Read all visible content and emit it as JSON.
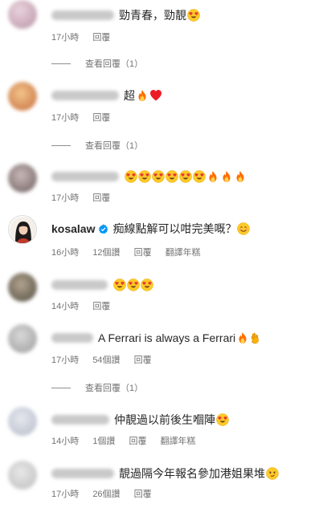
{
  "comments": [
    {
      "text": "勁青春，勁靚",
      "time": "17小時",
      "reply": "回覆",
      "view_replies": "查看回覆（1）"
    },
    {
      "text": "超",
      "time": "17小時",
      "reply": "回覆",
      "view_replies": "查看回覆（1）"
    },
    {
      "text": "",
      "time": "17小時",
      "reply": "回覆"
    },
    {
      "username": "kosalaw",
      "text": "痴線點解可以咁完美嘅？",
      "time": "16小時",
      "likes": "12個讚",
      "reply": "回覆",
      "translate": "翻譯年糕"
    },
    {
      "text": "",
      "time": "14小時",
      "reply": "回覆"
    },
    {
      "text": "A Ferrari is always a Ferrari",
      "time": "17小時",
      "likes": "54個讚",
      "reply": "回覆",
      "view_replies": "查看回覆（1）"
    },
    {
      "text": "仲靚過以前後生嗰陣",
      "time": "14小時",
      "likes": "1個讚",
      "reply": "回覆",
      "translate": "翻譯年糕"
    },
    {
      "text": "靚過隔今年報名參加港姐果堆",
      "time": "17小時",
      "likes": "26個讚",
      "reply": "回覆"
    }
  ],
  "icons": {
    "heart_eyes": "heart-eyes-emoji",
    "fire": "fire-emoji",
    "heart": "red-heart-emoji",
    "clap": "clapping-hands-emoji",
    "smile": "smiling-face-emoji",
    "wink": "smirk-face-emoji",
    "verified": "verified-badge-icon"
  },
  "colors": {
    "meta_text": "#737373",
    "verified_blue": "#0095f6",
    "heart_red": "#ed1c24"
  }
}
